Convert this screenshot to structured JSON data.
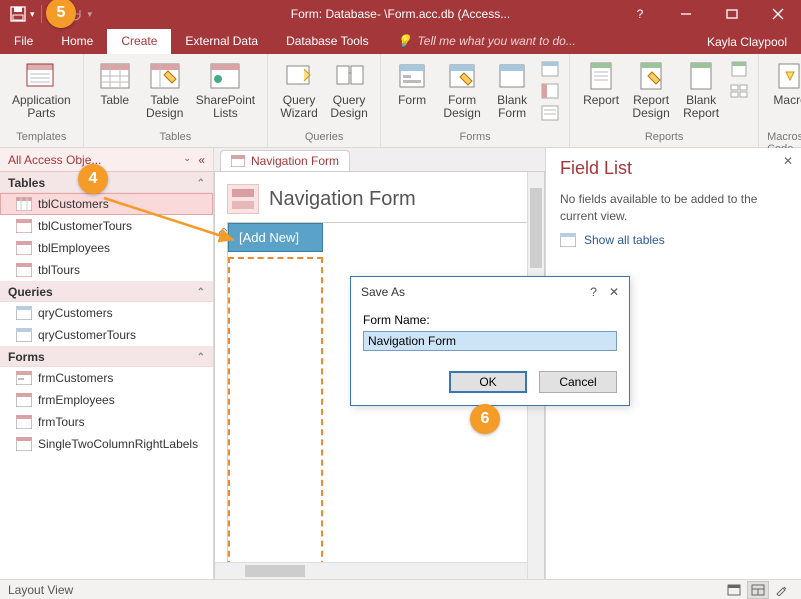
{
  "titlebar": {
    "title": "Form: Database- \\Form.acc.db (Access..."
  },
  "menubar": {
    "items": [
      "File",
      "Home",
      "Create",
      "External Data",
      "Database Tools"
    ],
    "active_index": 2,
    "tellme": "Tell me what you want to do...",
    "user": "Kayla Claypool"
  },
  "ribbon": {
    "groups": [
      {
        "label": "Templates",
        "items": [
          {
            "label": "Application\nParts",
            "dd": true
          }
        ]
      },
      {
        "label": "Tables",
        "items": [
          {
            "label": "Table"
          },
          {
            "label": "Table\nDesign"
          },
          {
            "label": "SharePoint\nLists",
            "dd": true
          }
        ]
      },
      {
        "label": "Queries",
        "items": [
          {
            "label": "Query\nWizard"
          },
          {
            "label": "Query\nDesign"
          }
        ]
      },
      {
        "label": "Forms",
        "items": [
          {
            "label": "Form"
          },
          {
            "label": "Form\nDesign"
          },
          {
            "label": "Blank\nForm"
          }
        ]
      },
      {
        "label": "Reports",
        "items": [
          {
            "label": "Report"
          },
          {
            "label": "Report\nDesign"
          },
          {
            "label": "Blank\nReport"
          }
        ]
      },
      {
        "label": "Macros & Code",
        "items": [
          {
            "label": "Macro"
          }
        ]
      }
    ]
  },
  "navpane": {
    "title": "All Access Obje...",
    "sections": [
      {
        "label": "Tables",
        "items": [
          "tblCustomers",
          "tblCustomerTours",
          "tblEmployees",
          "tblTours"
        ],
        "selected": 0
      },
      {
        "label": "Queries",
        "items": [
          "qryCustomers",
          "qryCustomerTours"
        ]
      },
      {
        "label": "Forms",
        "items": [
          "frmCustomers",
          "frmEmployees",
          "frmTours",
          "SingleTwoColumnRightLabels"
        ]
      }
    ]
  },
  "doc": {
    "tab": "Navigation Form",
    "header": "Navigation Form",
    "addnew": "[Add New]"
  },
  "fieldlist": {
    "title": "Field List",
    "msg": "No fields available to be added to the current view.",
    "link": "Show all tables"
  },
  "dialog": {
    "title": "Save As",
    "label": "Form Name:",
    "value": "Navigation Form",
    "ok": "OK",
    "cancel": "Cancel"
  },
  "statusbar": {
    "label": "Layout View"
  },
  "callouts": {
    "c4": "4",
    "c5": "5",
    "c6": "6"
  }
}
